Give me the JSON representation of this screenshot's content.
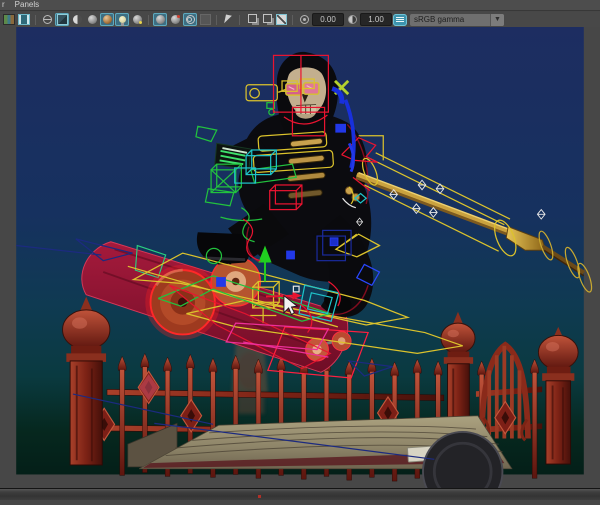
{
  "menu_bar": {
    "items": [
      {
        "label": "r"
      },
      {
        "label": "Panels"
      }
    ]
  },
  "toolbar": {
    "exposure_value": "0.00",
    "gamma_value": "1.00",
    "view_transform": "sRGB gamma",
    "dropdown_arrow": "▼",
    "icon_names": [
      "camera-image-icon",
      "film-gate-icon",
      "wireframe-mode-icon",
      "shaded-mode-icon",
      "material-ball-icon",
      "wireframe-on-shaded-icon",
      "textured-mode-icon",
      "lighting-icon",
      "shadows-icon",
      "default-material-icon",
      "paint-mode-icon",
      "xray-mode-icon",
      "plugin-shading-icon",
      "select-tool-icon",
      "copy-layer-icon",
      "paste-layer-icon",
      "isolate-select-icon",
      "exposure-icon",
      "contrast-icon",
      "gamma-correct-icon",
      "view-transform-dropdown"
    ]
  },
  "viewport": {
    "objects": [
      "grim-reaper-character",
      "skull-face",
      "sunglasses",
      "skateboard",
      "skateboard-wheels",
      "scythe-staff",
      "rig-control-curves",
      "iron-fence",
      "fence-gate",
      "stone-finial-posts",
      "wooden-crate",
      "cart-wheel",
      "gargoyle-statue",
      "mouse-cursor"
    ],
    "colors": {
      "bg_top": "#1d2d61",
      "bg_mid_blue": "#16315f",
      "bg_teal": "#0f3a52",
      "bg_bottom": "#041f18",
      "rig_red": "#ea1430",
      "rig_yellow": "#dcc32c",
      "rig_green": "#22c23e",
      "rig_cyan": "#1fc3c9",
      "rig_blue": "#2238e8",
      "rig_navy": "#1c2a80",
      "rig_magenta": "#ee2f9a",
      "deck": "#8e1130",
      "wheel": "#c4563a",
      "fence_rust": "#93291c",
      "staff_gold": "#c9a23f",
      "toolbar_active": "#3d6e82"
    }
  }
}
